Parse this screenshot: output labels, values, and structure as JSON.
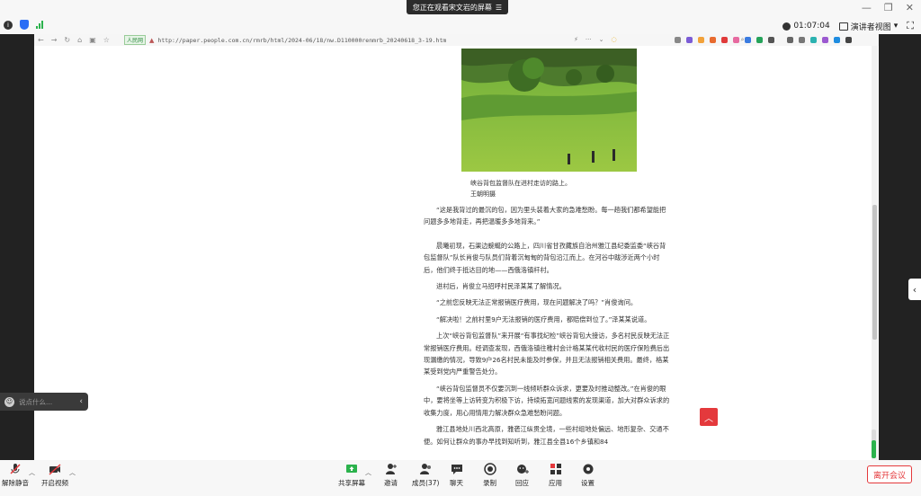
{
  "meeting": {
    "share_banner": "您正在观看宋文岩的屏幕",
    "timer": "01:07:04",
    "view_mode": "演讲者视图",
    "leave_button": "离开会议",
    "chat_placeholder": "说点什么...",
    "toolbar": {
      "mute": "解除静音",
      "video": "开启视频",
      "share": "共享屏幕",
      "invite": "邀请",
      "members": "成员(37)",
      "chat": "聊天",
      "record": "录制",
      "reaction": "回应",
      "apps": "应用",
      "settings": "设置"
    }
  },
  "browser": {
    "site_badge": "人民网",
    "url": "http://paper.people.com.cn/rmrb/html/2024-06/18/nw.D110000renmrb_20240618_3-19.htm"
  },
  "article": {
    "caption_line1": "峡谷背包监督队在进村走访的路上。",
    "caption_line2": "王朝明摄",
    "paragraphs": [
      "“这是我背过的最沉的包，因为里头装着大家的急难愁盼。每一趟我们都希望能把问题多多地背走，再把温暖多多地背来。”",
      "晨曦初现，石渠边蜿蜒的公路上，四川省甘孜藏族自治州雅江县纪委监委“峡谷背包监督队”队长肖俊与队员们背着沉甸甸的背包沿江而上。在河谷中跋涉近两个小时后，他们终于抵达目的地——西俄洛镇杆村。",
      "进村后，肖俊立马招呼村民泽某某了解情况。",
      "“之前您反映无法正常报销医疗费用，现在问题解决了吗？”肖俊询问。",
      "“解决啦！之前村里9户无法报销的医疗费用，都赔偿到位了。”泽某某说道。",
      "上次“峡谷背包监督队”来开展“有事找纪检”峡谷背包大接访，多名村民反映无法正常报销医疗费用。经调查发现，西俄洛镇往稚村会计格某某代收村民的医疗保险费后出现漏缴的情况，导致9户26名村民未能及时参保，并且无法报销相关费用。最终，格某某受到党内严重警告处分。",
      "“峡谷背包监督员不仅要沉到一线倾听群众诉求，更要及时推动整改。”在肖俊的眼中，要将坐等上访转变为积极下访，持续拓宽问题线索的发现渠道，加大对群众诉求的收集力度，用心用情用力解决群众急难愁盼问题。",
      "雅江县地处川西北高原，雅砻江纵贯全境，一些村组地处偏远、地形复杂、交通不便。如何让群众的事办早找到知听到，雅江县全县16个乡镇和84"
    ]
  }
}
